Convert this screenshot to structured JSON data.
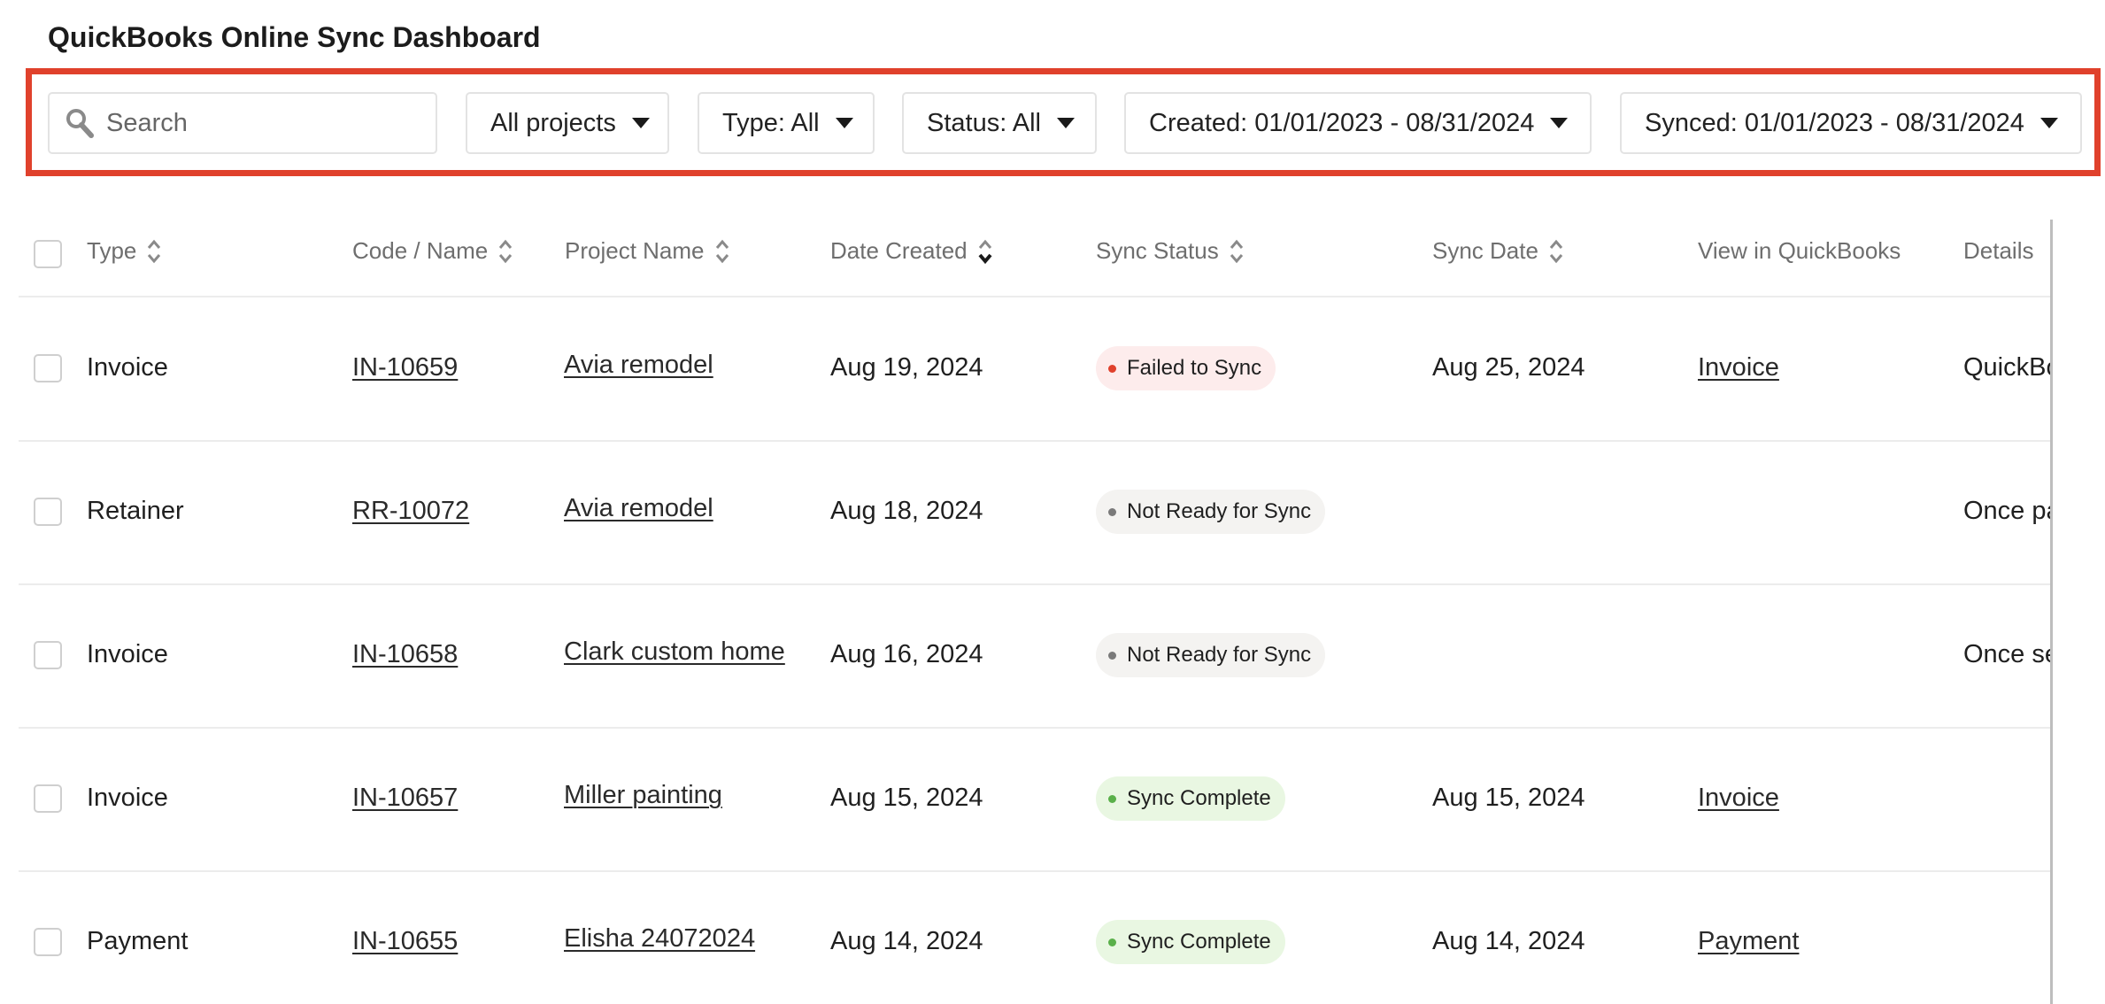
{
  "page_title": "QuickBooks Online Sync Dashboard",
  "filters": {
    "search_placeholder": "Search",
    "projects": "All projects",
    "type": "Type: All",
    "status": "Status: All",
    "created": "Created: 01/01/2023 - 08/31/2024",
    "synced": "Synced: 01/01/2023 - 08/31/2024",
    "highlight_color": "#e0412c"
  },
  "columns": {
    "type": "Type",
    "code_name": "Code / Name",
    "project_name": "Project Name",
    "date_created": "Date Created",
    "sync_status": "Sync Status",
    "sync_date": "Sync Date",
    "view_in_qb": "View in QuickBooks",
    "details": "Details"
  },
  "rows": [
    {
      "type": "Invoice",
      "code": "IN-10659",
      "project": "Avia remodel",
      "created": "Aug 19, 2024",
      "status": "Failed to Sync",
      "status_kind": "failed",
      "sync_date": "Aug 25, 2024",
      "view": "Invoice",
      "details": "QuickBo"
    },
    {
      "type": "Retainer",
      "code": "RR-10072",
      "project": "Avia remodel",
      "created": "Aug 18, 2024",
      "status": "Not Ready for Sync",
      "status_kind": "notready",
      "sync_date": "",
      "view": "",
      "details": "Once pa"
    },
    {
      "type": "Invoice",
      "code": "IN-10658",
      "project": "Clark custom home",
      "created": "Aug 16, 2024",
      "status": "Not Ready for Sync",
      "status_kind": "notready",
      "sync_date": "",
      "view": "",
      "details": "Once se"
    },
    {
      "type": "Invoice",
      "code": "IN-10657",
      "project": "Miller painting",
      "created": "Aug 15, 2024",
      "status": "Sync Complete",
      "status_kind": "complete",
      "sync_date": "Aug 15, 2024",
      "view": "Invoice",
      "details": ""
    },
    {
      "type": "Payment",
      "code": "IN-10655",
      "project": "Elisha 24072024",
      "created": "Aug 14, 2024",
      "status": "Sync Complete",
      "status_kind": "complete",
      "sync_date": "Aug 14, 2024",
      "view": "Payment",
      "details": ""
    }
  ],
  "status_colors": {
    "failed": {
      "bg": "#fdecec",
      "dot": "#e0412c"
    },
    "notready": {
      "bg": "#f4f3f1",
      "dot": "#7a7a7a"
    },
    "complete": {
      "bg": "#e9f7e2",
      "dot": "#5ab04a"
    }
  }
}
